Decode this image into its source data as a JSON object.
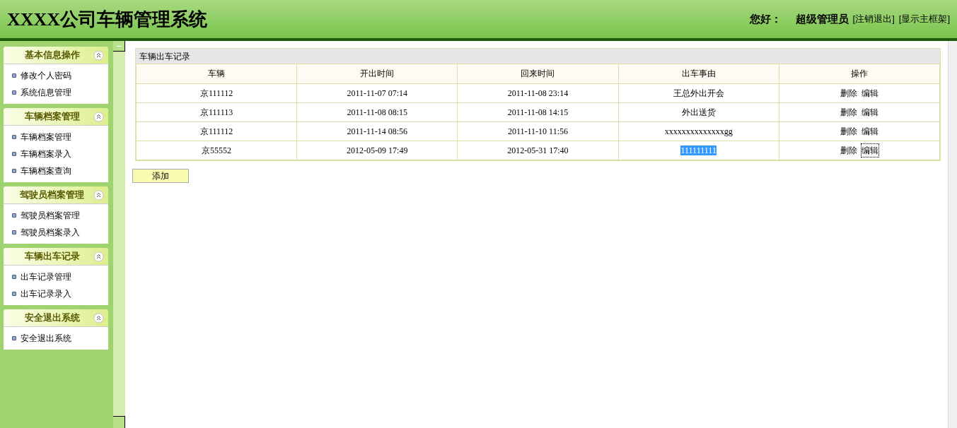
{
  "header": {
    "title": "XXXX公司车辆管理系统",
    "greeting": "您好：",
    "user": "超级管理员",
    "links": [
      "[注销退出]",
      "[显示主框架]"
    ]
  },
  "sidebar": {
    "sections": [
      {
        "title": "基本信息操作",
        "expanded": true,
        "items": [
          "修改个人密码",
          "系统信息管理"
        ]
      },
      {
        "title": "车辆档案管理",
        "expanded": true,
        "items": [
          "车辆档案管理",
          "车辆档案录入",
          "车辆档案查询"
        ]
      },
      {
        "title": "驾驶员档案管理",
        "expanded": true,
        "items": [
          "驾驶员档案管理",
          "驾驶员档案录入"
        ]
      },
      {
        "title": "车辆出车记录",
        "expanded": true,
        "items": [
          "出车记录管理",
          "出车记录录入"
        ]
      },
      {
        "title": "安全退出系统",
        "expanded": true,
        "items": [
          "安全退出系统"
        ]
      }
    ]
  },
  "table": {
    "caption": "车辆出车记录",
    "columns": [
      "车辆",
      "开出时间",
      "回来时间",
      "出车事由",
      "操作"
    ],
    "rows": [
      {
        "vehicle": "京111112",
        "departed": "2011-11-07 07:14",
        "returned": "2011-11-08 23:14",
        "reason": "王总外出开会",
        "reason_selected": false,
        "actions": [
          {
            "label": "删除",
            "focused": false
          },
          {
            "label": "编辑",
            "focused": false
          }
        ]
      },
      {
        "vehicle": "京111113",
        "departed": "2011-11-08 08:15",
        "returned": "2011-11-08 14:15",
        "reason": "外出送货",
        "reason_selected": false,
        "actions": [
          {
            "label": "删除",
            "focused": false
          },
          {
            "label": "编辑",
            "focused": false
          }
        ]
      },
      {
        "vehicle": "京111112",
        "departed": "2011-11-14 08:56",
        "returned": "2011-11-10 11:56",
        "reason": "xxxxxxxxxxxxxxgg",
        "reason_selected": false,
        "actions": [
          {
            "label": "删除",
            "focused": false
          },
          {
            "label": "编辑",
            "focused": false
          }
        ]
      },
      {
        "vehicle": "京55552",
        "departed": "2012-05-09 17:49",
        "returned": "2012-05-31 17:40",
        "reason": "111111111",
        "reason_selected": true,
        "actions": [
          {
            "label": "删除",
            "focused": false
          },
          {
            "label": "编辑",
            "focused": true
          }
        ]
      }
    ]
  },
  "add_button": "添加"
}
